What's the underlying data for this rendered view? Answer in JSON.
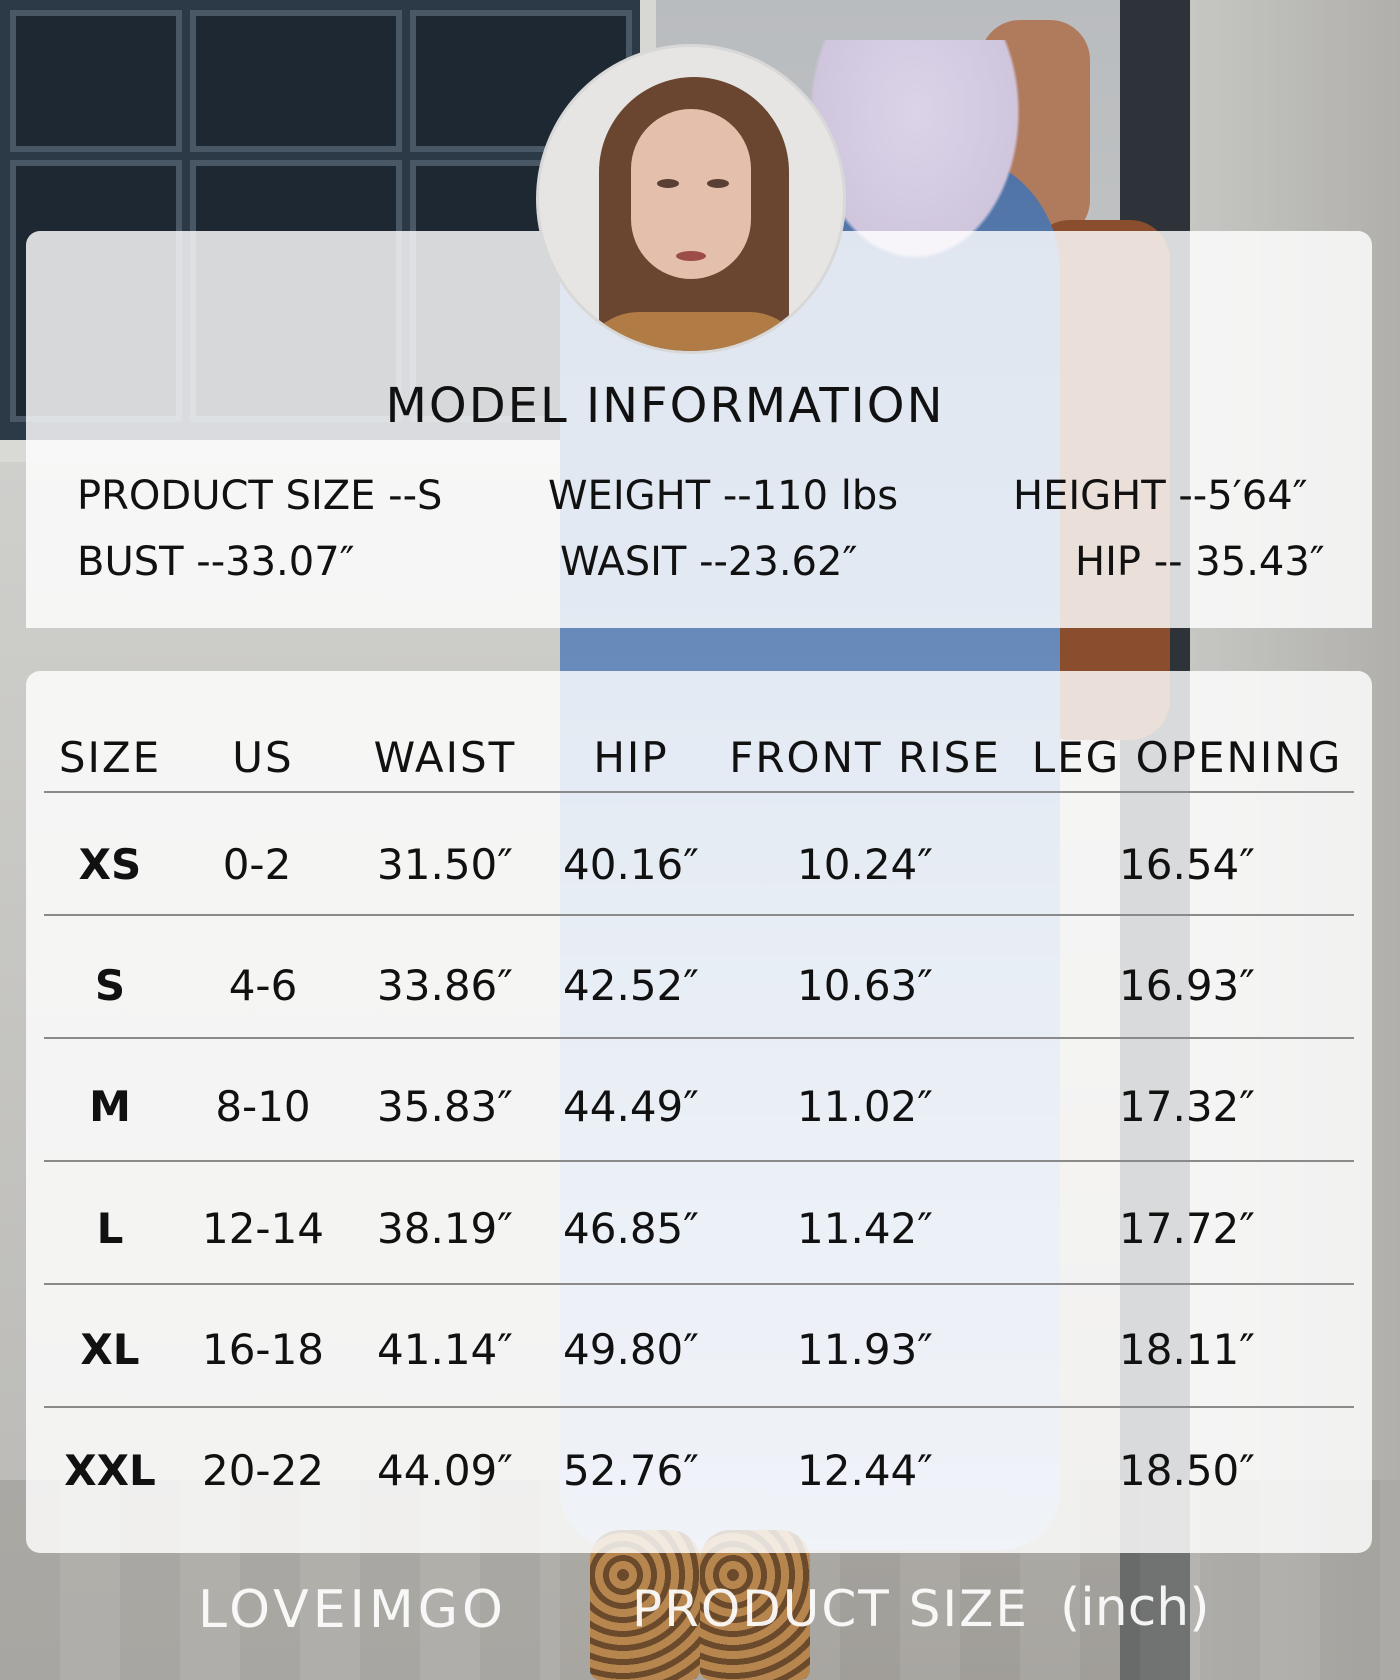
{
  "model_info": {
    "title": "MODEL INFORMATION",
    "product_size": "PRODUCT SIZE --S",
    "weight": "WEIGHT --110 lbs",
    "height": "HEIGHT --5′64″",
    "bust": "BUST --33.07″",
    "waist": "WASIT --23.62″",
    "hip": "HIP -- 35.43″"
  },
  "size_table": {
    "headers": [
      "SIZE",
      "US",
      "WAIST",
      "HIP",
      "FRONT RISE",
      "LEG OPENING"
    ],
    "rows": [
      [
        "XS",
        "0-2",
        "31.50″",
        "40.16″",
        "10.24″",
        "16.54″"
      ],
      [
        "S",
        "4-6",
        "33.86″",
        "42.52″",
        "10.63″",
        "16.93″"
      ],
      [
        "M",
        "8-10",
        "35.83″",
        "44.49″",
        "11.02″",
        "17.32″"
      ],
      [
        "L",
        "12-14",
        "38.19″",
        "46.85″",
        "11.42″",
        "17.72″"
      ],
      [
        "XL",
        "16-18",
        "41.14″",
        "49.80″",
        "11.93″",
        "18.11″"
      ],
      [
        "XXL",
        "20-22",
        "44.09″",
        "52.76″",
        "12.44″",
        "18.50″"
      ]
    ]
  },
  "footer": {
    "brand": "LOVEIMGO",
    "title": "PRODUCT SIZE",
    "unit": "(inch)"
  }
}
